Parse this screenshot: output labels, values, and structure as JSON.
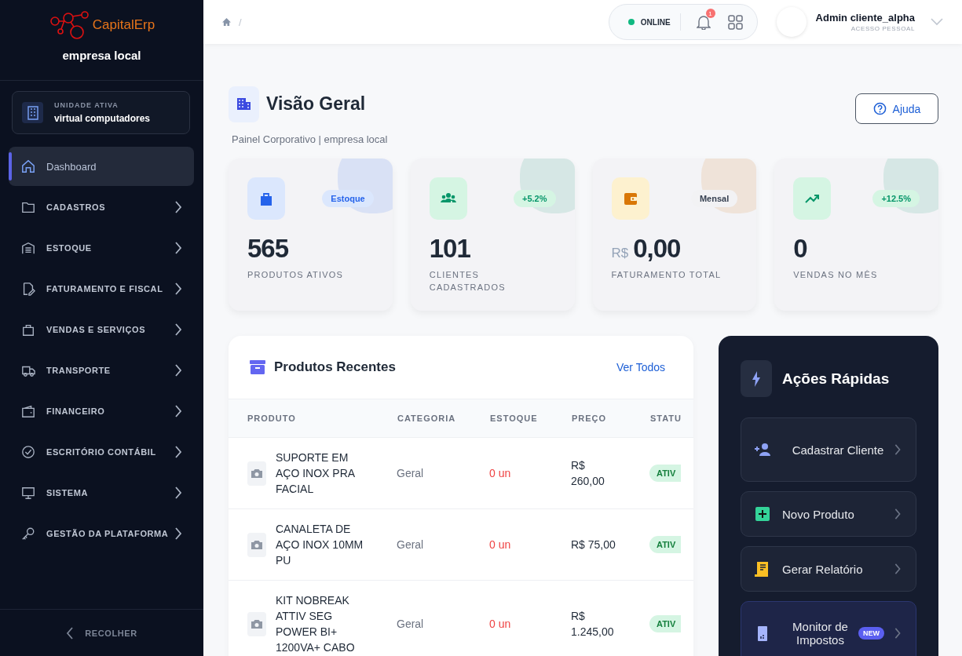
{
  "sidebar": {
    "logo": "CapitalErp",
    "company": "empresa local",
    "unit": {
      "label": "UNIDADE ATIVA",
      "name": "virtual computadores"
    },
    "items": [
      {
        "label": "Dashboard",
        "selected": true,
        "expandable": false
      },
      {
        "label": "CADASTROS",
        "selected": false,
        "expandable": true
      },
      {
        "label": "ESTOQUE",
        "selected": false,
        "expandable": true
      },
      {
        "label": "FATURAMENTO E FISCAL",
        "selected": false,
        "expandable": true
      },
      {
        "label": "VENDAS E SERVIÇOS",
        "selected": false,
        "expandable": true
      },
      {
        "label": "TRANSPORTE",
        "selected": false,
        "expandable": true
      },
      {
        "label": "FINANCEIRO",
        "selected": false,
        "expandable": true
      },
      {
        "label": "ESCRITÓRIO CONTÁBIL",
        "selected": false,
        "expandable": true
      },
      {
        "label": "SISTEMA",
        "selected": false,
        "expandable": true
      },
      {
        "label": "GESTÃO DA PLATAFORMA",
        "selected": false,
        "expandable": true
      }
    ],
    "collapse": "RECOLHER"
  },
  "header": {
    "breadcrumb_separator": "/",
    "status": "ONLINE",
    "notifications": "1",
    "user": {
      "name": "Admin cliente_alpha",
      "role": "ACESSO PESSOAL"
    }
  },
  "page": {
    "title": "Visão Geral",
    "subtitle": "Painel Corporativo | empresa local",
    "help": "Ajuda"
  },
  "stats": [
    {
      "value": "565",
      "label": "PRODUTOS ATIVOS",
      "badge": "Estoque",
      "kind": "category",
      "color": "#2563eb"
    },
    {
      "value": "101",
      "label": "CLIENTES CADASTRADOS",
      "badge": "+5.2%",
      "kind": "growth",
      "color": "#059669"
    },
    {
      "prefix": "R$",
      "value": "0,00",
      "label": "FATURAMENTO TOTAL",
      "badge": "Mensal",
      "kind": "period",
      "color": "#d97706"
    },
    {
      "value": "0",
      "label": "VENDAS NO MÊS",
      "badge": "+12.5%",
      "kind": "growth",
      "color": "#059669"
    }
  ],
  "products": {
    "title": "Produtos Recentes",
    "link": "Ver Todos",
    "columns": [
      "PRODUTO",
      "CATEGORIA",
      "ESTOQUE",
      "PREÇO",
      "STATU"
    ],
    "rows": [
      {
        "name": "SUPORTE EM AÇO INOX PRA FACIAL",
        "category": "Geral",
        "stock": "0 un",
        "out_of_stock": true,
        "price": "R$ 260,00",
        "status": "ATIV"
      },
      {
        "name": "CANALETA DE AÇO INOX 10MM PU",
        "category": "Geral",
        "stock": "0 un",
        "out_of_stock": true,
        "price": "R$ 75,00",
        "status": "ATIV"
      },
      {
        "name": "KIT NOBREAK ATTIV SEG POWER BI+ 1200VA+ CABO",
        "category": "Geral",
        "stock": "0 un",
        "out_of_stock": true,
        "price": "R$ 1.245,00",
        "status": "ATIV"
      }
    ]
  },
  "quick_actions": {
    "title": "Ações Rápidas",
    "items": [
      {
        "label": "Cadastrar Cliente",
        "featured": false
      },
      {
        "label": "Novo Produto",
        "featured": false
      },
      {
        "label": "Gerar Relatório",
        "featured": false
      },
      {
        "label": "Monitor de Impostos",
        "badge": "NEW",
        "featured": true
      }
    ]
  }
}
